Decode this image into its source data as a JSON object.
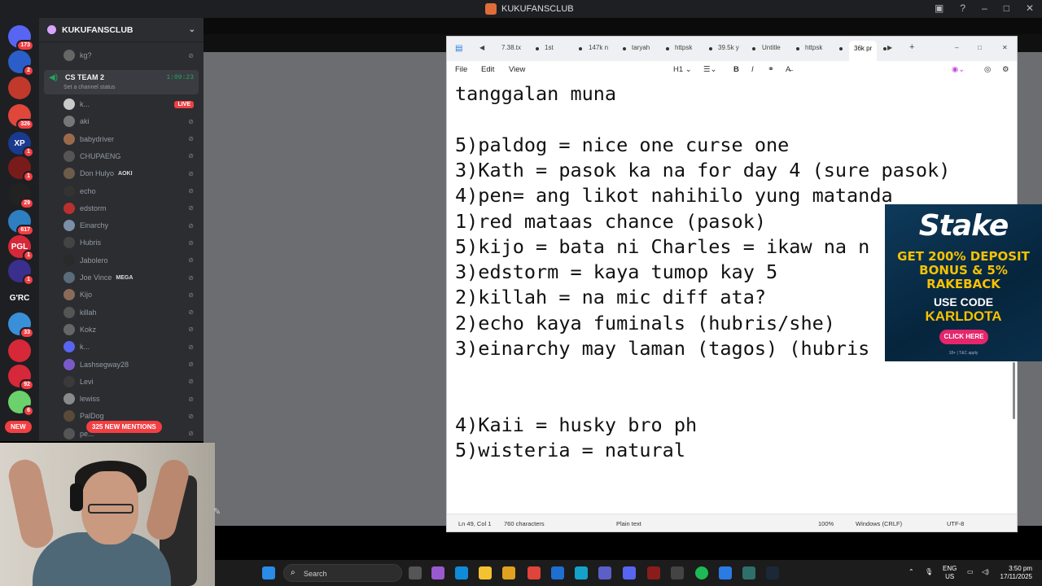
{
  "titlebar": {
    "title": "KUKUFANSCLUB"
  },
  "rail": {
    "servers": [
      {
        "label": "",
        "badge": "173",
        "color": "#5865f2"
      },
      {
        "label": "",
        "badge": "2",
        "color": "#2b5ec9"
      },
      {
        "label": "",
        "badge": "",
        "color": "#c0392b"
      },
      {
        "label": "",
        "badge": "326",
        "color": "#e0463a"
      },
      {
        "label": "XP",
        "badge": "1",
        "color": "#1a3a8f"
      },
      {
        "label": "",
        "badge": "1",
        "color": "#7a1b1b"
      },
      {
        "label": "",
        "badge": "29",
        "color": "#222"
      },
      {
        "label": "",
        "badge": "617",
        "color": "#2d7fc1"
      },
      {
        "label": "PGL",
        "badge": "1",
        "color": "#d62839"
      },
      {
        "label": "",
        "badge": "1",
        "color": "#3a2f8c"
      },
      {
        "label": "G'RC",
        "badge": "",
        "color": "#1e1f22"
      },
      {
        "label": "",
        "badge": "33",
        "color": "#3a8fd9"
      },
      {
        "label": "",
        "badge": "",
        "color": "#d62839"
      },
      {
        "label": "",
        "badge": "92",
        "color": "#d62839"
      },
      {
        "label": "",
        "badge": "6",
        "color": "#6bd16b"
      }
    ],
    "new_label": "NEW"
  },
  "sidebar": {
    "server_name": "KUKUFANSCLUB",
    "first_user": "kg?",
    "voice_channel": {
      "name": "CS TEAM 2",
      "status": "Set a channel status",
      "time": "1:09:23"
    },
    "live_label": "LIVE",
    "users": [
      {
        "name": "k...",
        "color": "#c9c9c9"
      },
      {
        "name": "aki",
        "color": "#777"
      },
      {
        "name": "babydriver",
        "color": "#9b6a4a"
      },
      {
        "name": "CHUPAENG",
        "color": "#555"
      },
      {
        "name": "Don Hulyo",
        "tag": "AOKI",
        "color": "#6d5c4a"
      },
      {
        "name": "echo",
        "color": "#333"
      },
      {
        "name": "edstorm",
        "color": "#ba3030"
      },
      {
        "name": "Einarchy",
        "color": "#7a8fa8"
      },
      {
        "name": "Hubris",
        "color": "#444"
      },
      {
        "name": "Jabolero",
        "color": "#2a2a2a"
      },
      {
        "name": "Joe Vince",
        "tag": "MEGA",
        "color": "#5a6b7a"
      },
      {
        "name": "Kijo",
        "color": "#8a6b5a"
      },
      {
        "name": "killah",
        "color": "#555"
      },
      {
        "name": "Kokz",
        "color": "#666"
      },
      {
        "name": "k...",
        "color": "#5865f2"
      },
      {
        "name": "Lashsegway28",
        "color": "#7a5ac9"
      },
      {
        "name": "Levi",
        "color": "#3a3a3a"
      },
      {
        "name": "lewiss",
        "color": "#8a8a8a"
      },
      {
        "name": "PalDog",
        "color": "#5a4a3a"
      },
      {
        "name": "pe...",
        "color": "#555"
      }
    ],
    "mentions": "325 NEW MENTIONS"
  },
  "notepad": {
    "tabs": [
      "7.38.tx",
      "1st",
      "147k n",
      "taryah",
      "httpsk",
      "39.5k y",
      "Untitle",
      "httpsk",
      "36k pr"
    ],
    "menu": [
      "File",
      "Edit",
      "View"
    ],
    "heading_label": "H1",
    "lines": [
      "tanggalan muna",
      "",
      "5)paldog = nice one curse one",
      "3)Kath = pasok ka na for day 4 (sure pasok)",
      "4)pen= ang likot nahihilo yung matanda",
      "1)red mataas chance (pasok)",
      "5)kijo = bata ni Charles = ikaw na n",
      "3)edstorm = kaya tumop kay 5",
      "2)killah = na mic diff ata?",
      "2)echo kaya fuminals (hubris/she)",
      "3)einarchy may laman (tagos) (hubris",
      "",
      "",
      "4)Kaii = husky bro ph",
      "5)wisteria = natural"
    ],
    "status": {
      "position": "Ln 49, Col 1",
      "chars": "760 characters",
      "format": "Plain text",
      "zoom": "100%",
      "eol": "Windows (CRLF)",
      "encoding": "UTF-8"
    }
  },
  "ad": {
    "brand": "Stake",
    "line1": "GET 200% DEPOSIT",
    "line2": "BONUS & 5%",
    "line3": "RAKEBACK",
    "use": "USE CODE",
    "code": "KARLDOTA",
    "cta": "CLICK HERE",
    "small": "18+ | T&C apply"
  },
  "taskbar": {
    "search_placeholder": "Search",
    "lang1": "ENG",
    "lang2": "US",
    "time": "3:50 pm",
    "date": "17/11/2025"
  }
}
